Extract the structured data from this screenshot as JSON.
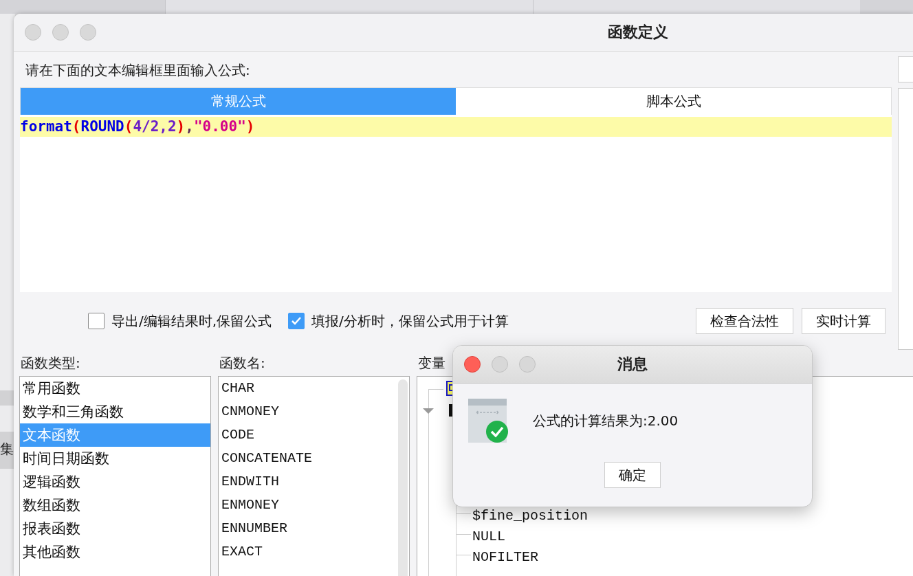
{
  "background_app": {
    "side_label": "集"
  },
  "window": {
    "title": "函数定义",
    "prompt": "请在下面的文本编辑框里面输入公式:",
    "tabs": [
      {
        "label": "常规公式",
        "selected": true
      },
      {
        "label": "脚本公式",
        "selected": false
      }
    ],
    "formula": [
      {
        "kind": "function",
        "text": "format"
      },
      {
        "kind": "paren",
        "text": "("
      },
      {
        "kind": "function",
        "text": "ROUND"
      },
      {
        "kind": "paren",
        "text": "("
      },
      {
        "kind": "argument",
        "text": "4/2,2"
      },
      {
        "kind": "paren",
        "text": ")"
      },
      {
        "kind": "separator",
        "text": ","
      },
      {
        "kind": "string",
        "text": "\"0.00\""
      },
      {
        "kind": "paren",
        "text": ")"
      }
    ],
    "options": [
      {
        "label": "导出/编辑结果时,保留公式",
        "checked": false
      },
      {
        "label": "填报/分析时，保留公式用于计算",
        "checked": true
      }
    ],
    "buttons": [
      "检查合法性",
      "实时计算"
    ],
    "function_types": {
      "label": "函数类型:",
      "items": [
        {
          "label": "常用函数",
          "selected": false
        },
        {
          "label": "数学和三角函数",
          "selected": false
        },
        {
          "label": "文本函数",
          "selected": true
        },
        {
          "label": "时间日期函数",
          "selected": false
        },
        {
          "label": "逻辑函数",
          "selected": false
        },
        {
          "label": "数组函数",
          "selected": false
        },
        {
          "label": "报表函数",
          "selected": false
        },
        {
          "label": "其他函数",
          "selected": false
        }
      ]
    },
    "function_names": {
      "label": "函数名:",
      "items": [
        "CHAR",
        "CNMONEY",
        "CODE",
        "CONCATENATE",
        "ENDWITH",
        "ENMONEY",
        "ENNUMBER",
        "EXACT"
      ]
    },
    "variables": {
      "label": "变量",
      "items": [
        "$fine_position",
        "NULL",
        "NOFILTER"
      ]
    }
  },
  "dialog": {
    "title": "消息",
    "message": "公式的计算结果为:2.00",
    "button": "确定"
  }
}
